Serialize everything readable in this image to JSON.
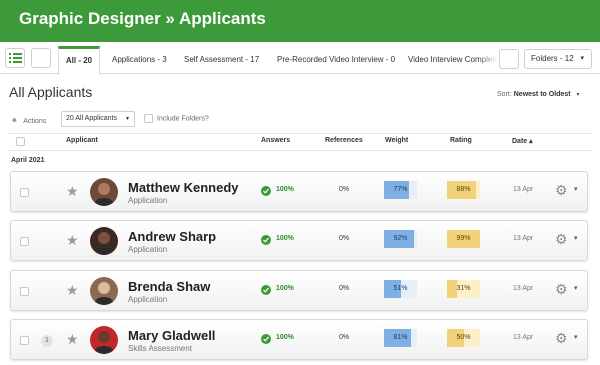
{
  "header": {
    "title": "Graphic Designer » Applicants"
  },
  "tabs": [
    {
      "label": "All - 20"
    },
    {
      "label": "Applications - 3"
    },
    {
      "label": "Self Assessment - 17"
    },
    {
      "label": "Pre-Recorded Video Interview - 0"
    },
    {
      "label": "Video Interview Complete"
    }
  ],
  "folders_button": {
    "label": "Folders - 12",
    "caret": "▾"
  },
  "page": {
    "title": "All Applicants",
    "sort_label": "Sort:",
    "sort_value": "Newest to Oldest",
    "sort_caret": "▾"
  },
  "toolbar": {
    "actions_icon": "✷",
    "actions_label": "Actions",
    "filter_value": "20 All Applicants",
    "filter_caret": "▾",
    "include_folders_label": "Include Folders?"
  },
  "columns": {
    "applicant": "Applicant",
    "answers": "Answers",
    "references": "References",
    "weight": "Weight",
    "rating": "Rating",
    "date": "Date ▴"
  },
  "group_label": "April 2021",
  "colors": {
    "brand_green": "#3c9a3a",
    "weight_fill": "#7eb0e3",
    "rating_fill": "#f1d27a"
  },
  "icons": {
    "star": "★",
    "gear": "⚙",
    "caret": "▾"
  },
  "applicants": [
    {
      "name": "Matthew Kennedy",
      "type": "Application",
      "answers": "100%",
      "references": "0%",
      "weight": "77%",
      "weight_value": 0.77,
      "rating": "88%",
      "rating_value": 0.88,
      "date": "13 Apr",
      "badge": "",
      "avatar_bg": "#6b4a3a",
      "avatar_fg": "#b07a5e"
    },
    {
      "name": "Andrew Sharp",
      "type": "Application",
      "answers": "100%",
      "references": "0%",
      "weight": "92%",
      "weight_value": 0.92,
      "rating": "99%",
      "rating_value": 0.99,
      "date": "13 Apr",
      "badge": "",
      "avatar_bg": "#3a2a22",
      "avatar_fg": "#7a5040"
    },
    {
      "name": "Brenda Shaw",
      "type": "Application",
      "answers": "100%",
      "references": "0%",
      "weight": "51%",
      "weight_value": 0.51,
      "rating": "31%",
      "rating_value": 0.31,
      "date": "13 Apr",
      "badge": "",
      "avatar_bg": "#8a6a55",
      "avatar_fg": "#e0b89a"
    },
    {
      "name": "Mary Gladwell",
      "type": "Skills Assessment",
      "answers": "100%",
      "references": "0%",
      "weight": "81%",
      "weight_value": 0.81,
      "rating": "50%",
      "rating_value": 0.5,
      "date": "13 Apr",
      "badge": "1",
      "avatar_bg": "#c0282a",
      "avatar_fg": "#6a3a2c"
    }
  ]
}
